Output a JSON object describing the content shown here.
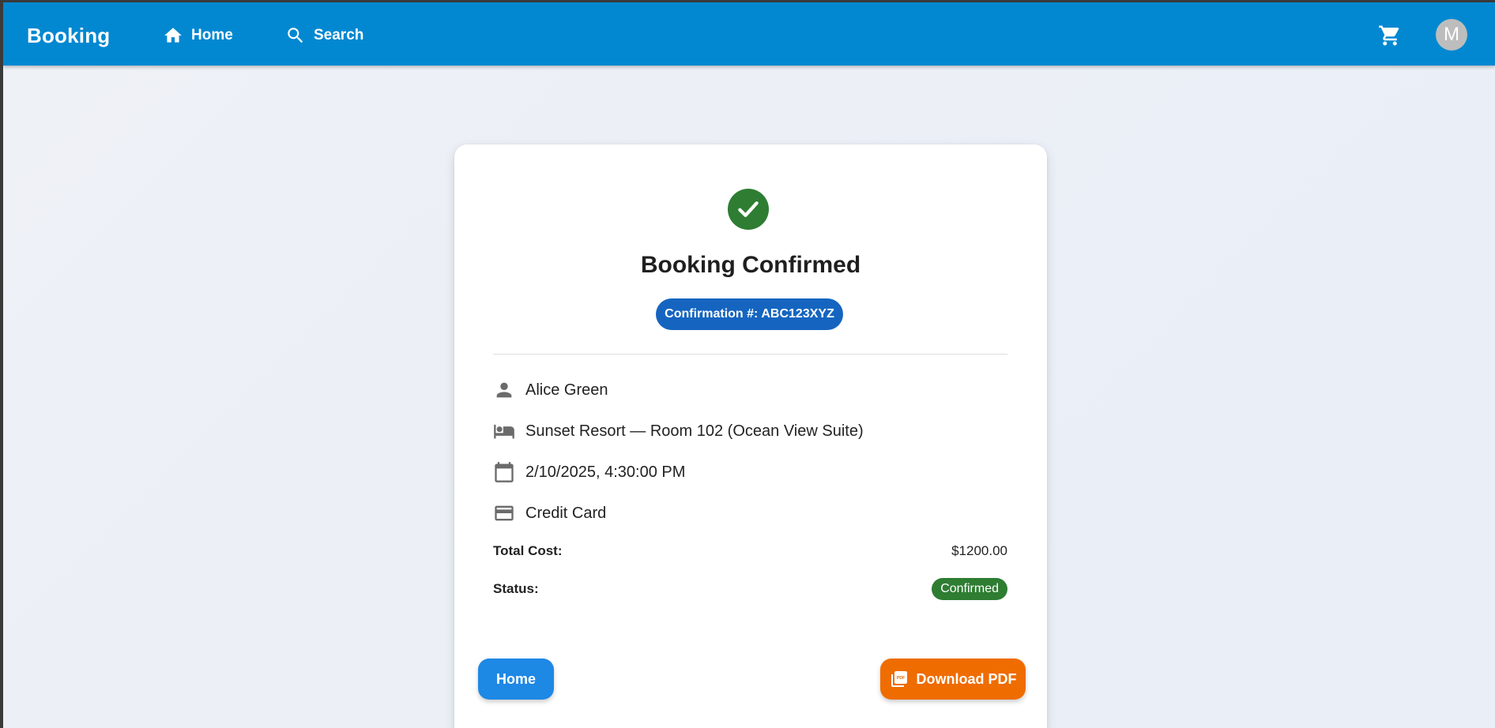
{
  "appbar": {
    "brand": "Booking",
    "nav": [
      {
        "label": "Home",
        "icon": "home-icon"
      },
      {
        "label": "Search",
        "icon": "search-icon"
      }
    ],
    "cart_icon": "shopping-cart-icon",
    "avatar_initial": "M",
    "color": "#0288d1"
  },
  "card": {
    "status_icon": "check-circle-icon",
    "title": "Booking Confirmed",
    "confirmation_label": "Confirmation #:",
    "confirmation_number": "ABC123XYZ",
    "details": [
      {
        "icon": "person-icon",
        "text": "Alice Green"
      },
      {
        "icon": "hotel-icon",
        "text": "Sunset Resort — Room 102 (Ocean View Suite)"
      },
      {
        "icon": "calendar-icon",
        "text": "2/10/2025, 4:30:00 PM"
      },
      {
        "icon": "credit-card-icon",
        "text": "Credit Card"
      }
    ],
    "total_cost_label": "Total Cost:",
    "total_cost_value": "$1200.00",
    "status_label": "Status:",
    "status_value": "Confirmed",
    "home_button": "Home",
    "pdf_button": "Download PDF"
  },
  "colors": {
    "success": "#2e7d32",
    "primary": "#1565c0",
    "home_button": "#1e88e5",
    "pdf_button": "#ef6c00"
  }
}
